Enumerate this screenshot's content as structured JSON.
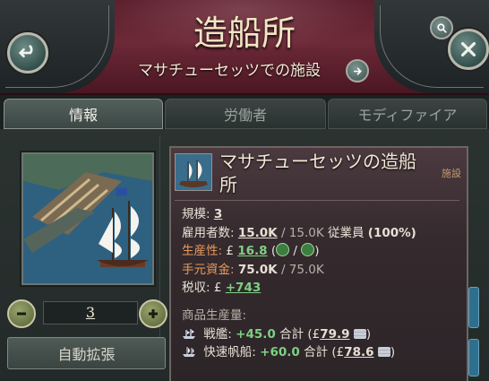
{
  "header": {
    "title": "造船所",
    "subtitle": "マサチューセッツでの施設"
  },
  "tabs": [
    {
      "label": "情報",
      "active": true
    },
    {
      "label": "労働者",
      "active": false
    },
    {
      "label": "モディファイア",
      "active": false
    }
  ],
  "level_control": {
    "value": "3"
  },
  "auto_expand_label": "自動拡張",
  "card": {
    "title": "マサチューセッツの造船所",
    "tag": "施設",
    "level_label": "規模:",
    "level_value": "3",
    "employment_label": "雇用者数:",
    "employment_current": "15.0K",
    "employment_max": "15.0K",
    "employment_suffix": "従業員",
    "employment_percent": "(100%)",
    "productivity_label": "生産性:",
    "productivity_value": "16.8",
    "cash_label": "手元資金:",
    "cash_current": "75.0K",
    "cash_max": "75.0K",
    "tax_label": "税収:",
    "tax_value": "+743",
    "currency": "£",
    "goods_heading": "商品生産量:",
    "goods": [
      {
        "icon": "warship-icon",
        "name": "戦艦:",
        "delta": "+45.0",
        "total_label": "合計",
        "total": "79.9"
      },
      {
        "icon": "clipper-icon",
        "name": "快速帆船:",
        "delta": "+60.0",
        "total_label": "合計",
        "total": "78.6"
      }
    ]
  },
  "colors": {
    "header_bg": "#6d2937",
    "positive": "#7ed084",
    "highlight": "#e79a5b"
  }
}
